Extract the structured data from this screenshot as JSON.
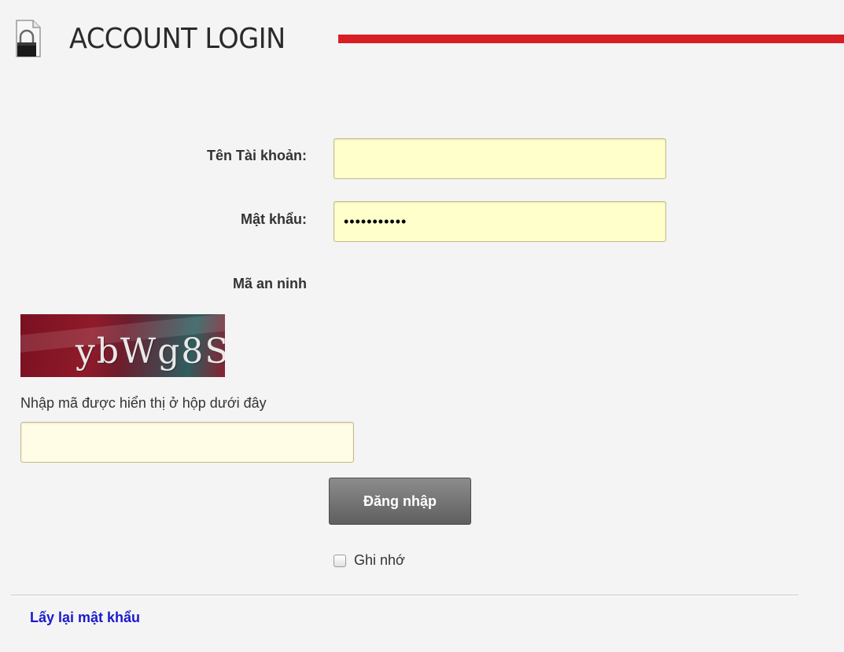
{
  "header": {
    "title": "ACCOUNT LOGIN",
    "icon": "lock-icon",
    "accent_color": "#d81e23"
  },
  "form": {
    "username_label": "Tên Tài khoản:",
    "username_value": "",
    "password_label": "Mật khẩu:",
    "password_value": "•••••••••••",
    "captcha_label": "Mã an ninh",
    "captcha_code": "ybWg8S",
    "captcha_hint": "Nhập mã được hiển thị ở hộp dưới đây",
    "captcha_value": "",
    "submit_label": "Đăng nhập",
    "remember_label": "Ghi nhớ",
    "remember_checked": false
  },
  "footer": {
    "forgot_password_link": "Lấy lại mật khẩu"
  }
}
